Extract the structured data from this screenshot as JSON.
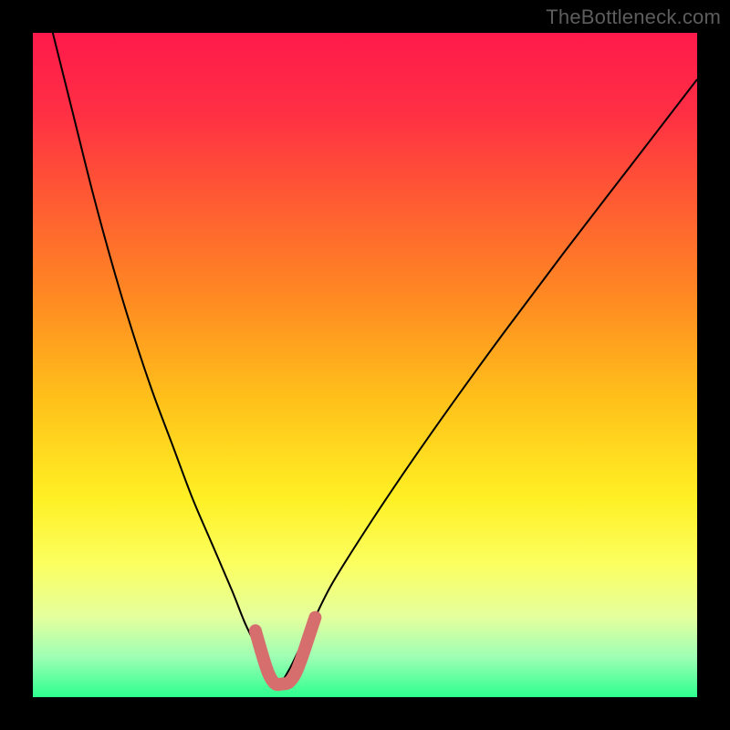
{
  "watermark": "TheBottleneck.com",
  "chart_data": {
    "type": "line",
    "title": "",
    "xlabel": "",
    "ylabel": "",
    "xlim": [
      0,
      100
    ],
    "ylim": [
      0,
      100
    ],
    "axes_visible": false,
    "grid": false,
    "legend": false,
    "background_gradient": {
      "stops": [
        {
          "pos": 0.0,
          "color": "#ff1a4b"
        },
        {
          "pos": 0.12,
          "color": "#ff2f44"
        },
        {
          "pos": 0.25,
          "color": "#ff5a33"
        },
        {
          "pos": 0.4,
          "color": "#ff8a22"
        },
        {
          "pos": 0.55,
          "color": "#ffc01a"
        },
        {
          "pos": 0.7,
          "color": "#fff024"
        },
        {
          "pos": 0.8,
          "color": "#fbff60"
        },
        {
          "pos": 0.88,
          "color": "#e4ff9e"
        },
        {
          "pos": 0.94,
          "color": "#9dffb4"
        },
        {
          "pos": 1.0,
          "color": "#2dff8e"
        }
      ]
    },
    "notch_x": 37,
    "series": [
      {
        "name": "bottleneck-curve",
        "color": "#000000",
        "width": 2,
        "x": [
          3,
          6,
          9,
          12,
          15,
          18,
          21,
          24,
          27,
          30,
          32,
          34,
          35.5,
          37,
          38.5,
          40,
          42,
          45,
          50,
          56,
          63,
          71,
          80,
          90,
          100
        ],
        "y": [
          100,
          88,
          76,
          65,
          55,
          46,
          38,
          30,
          23,
          16,
          11,
          7,
          4,
          2,
          4,
          7,
          11,
          17,
          25,
          34,
          44,
          55,
          67,
          80,
          93
        ]
      },
      {
        "name": "optimal-range-highlight",
        "color": "#d76e6e",
        "width": 14,
        "linecap": "round",
        "x": [
          33.5,
          34.5,
          35.5,
          36.5,
          37.5,
          38.5,
          39.5,
          40.5,
          41.5,
          42.5
        ],
        "y": [
          10,
          6.5,
          3.5,
          2,
          2,
          2.2,
          3.5,
          6,
          9,
          12
        ]
      }
    ],
    "annotations": []
  }
}
